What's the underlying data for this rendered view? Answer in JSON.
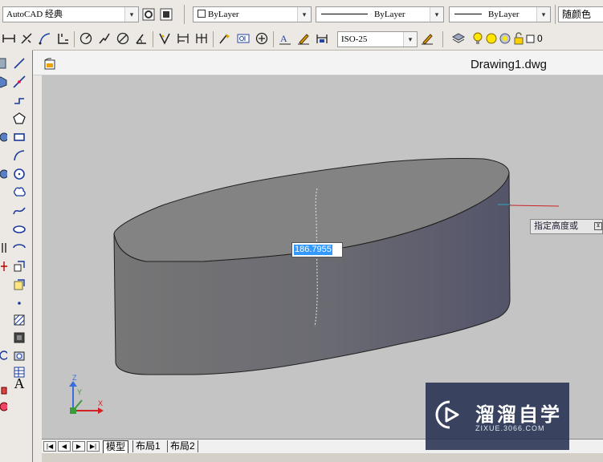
{
  "toolbar1": {
    "workspace": "AutoCAD 经典",
    "layer_color": "ByLayer",
    "linetype": "ByLayer",
    "lineweight": "ByLayer",
    "plot_color": "随颜色"
  },
  "toolbar2": {
    "dim_style": "ISO-25",
    "layer_state": "0"
  },
  "document": {
    "title": "Drawing1.dwg"
  },
  "dynamic_input": {
    "value": "186.7955",
    "prompt": "指定高度或",
    "option_glyph": "⊻"
  },
  "ucs": {
    "x_label": "X",
    "y_label": "Y",
    "z_label": "Z"
  },
  "layout_tabs": [
    {
      "label": "模型",
      "active": true
    },
    {
      "label": "布局1",
      "active": false
    },
    {
      "label": "布局2",
      "active": false
    }
  ],
  "nav_buttons": [
    "|◀",
    "◀",
    "▶",
    "▶|"
  ],
  "watermark": {
    "title": "溜溜自学",
    "subtitle": "ZIXUE.3066.COM"
  },
  "colors": {
    "viewport_bg": "#c4c4c4",
    "solid_top": "#828282",
    "solid_side_dark": "#5a5a6c",
    "selection_blue": "#3399ff",
    "crosshair_red": "#cc2222"
  }
}
